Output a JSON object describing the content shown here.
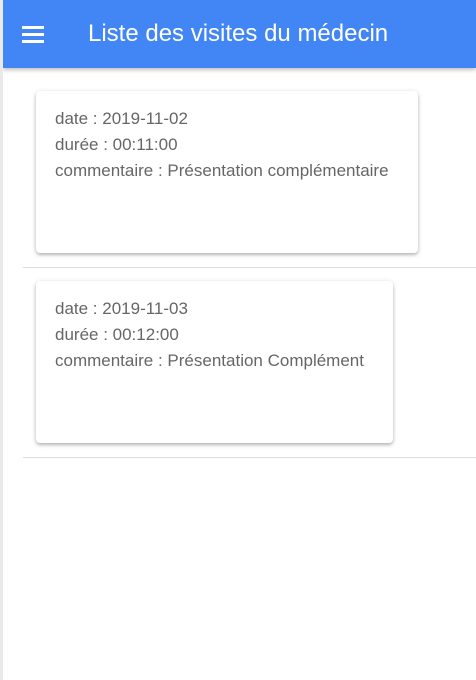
{
  "header": {
    "title": "Liste des visites du médecin",
    "background_color": "#4285f4",
    "menu_icon": "hamburger-menu-icon"
  },
  "visits": [
    {
      "date": "date : 2019-11-02",
      "duration": "durée : 00:11:00",
      "comment": "commentaire : Présentation complémentaire"
    },
    {
      "date": "date : 2019-11-03",
      "duration": "durée : 00:12:00",
      "comment": "commentaire : Présentation Complément"
    }
  ]
}
